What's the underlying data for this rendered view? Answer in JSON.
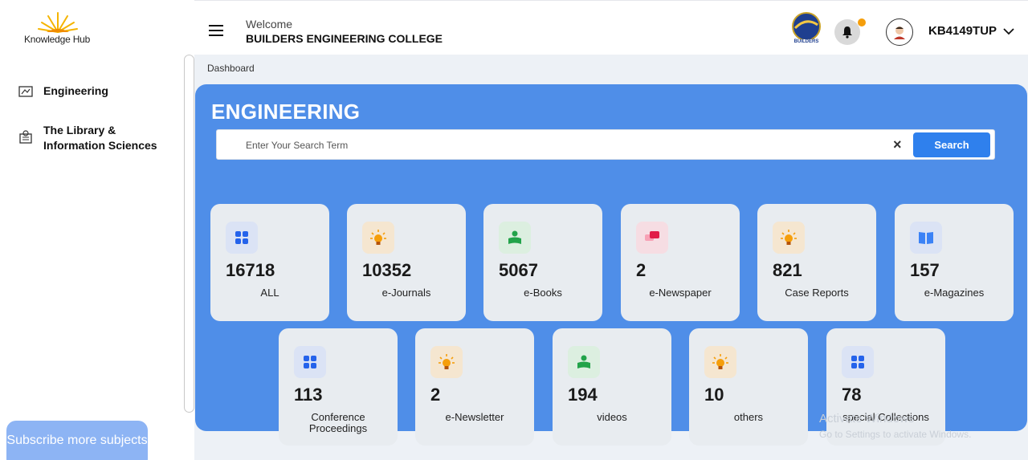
{
  "brand": {
    "logo_text": "Knowledge Hub"
  },
  "sidebar": {
    "items": [
      {
        "label": "Engineering",
        "icon": "engineering-icon"
      },
      {
        "label": "The Library &\nInformation Sciences",
        "icon": "library-icon"
      }
    ],
    "subscribe_label": "Subscribe more subjects"
  },
  "header": {
    "welcome": "Welcome",
    "college": "BUILDERS ENGINEERING COLLEGE",
    "college_logo_text": "BUILDERS",
    "user": "KB4149TUP"
  },
  "breadcrumb": "Dashboard",
  "panel": {
    "title": "ENGINEERING",
    "search_placeholder": "Enter Your Search Term",
    "clear_label": "×",
    "search_label": "Search"
  },
  "cards": [
    {
      "count": "16718",
      "label": "ALL",
      "icon": "grid-icon",
      "color": "blue"
    },
    {
      "count": "10352",
      "label": "e-Journals",
      "icon": "bulb-icon",
      "color": "orange"
    },
    {
      "count": "5067",
      "label": "e-Books",
      "icon": "reader-icon",
      "color": "green"
    },
    {
      "count": "2",
      "label": "e-Newspaper",
      "icon": "chat-icon",
      "color": "pink"
    },
    {
      "count": "821",
      "label": "Case Reports",
      "icon": "bulb-icon",
      "color": "orange"
    },
    {
      "count": "157",
      "label": "e-Magazines",
      "icon": "book-icon",
      "color": "blue"
    },
    {
      "count": "113",
      "label": "Conference Proceedings",
      "icon": "grid-icon",
      "color": "blue"
    },
    {
      "count": "2",
      "label": "e-Newsletter",
      "icon": "bulb-icon",
      "color": "orange"
    },
    {
      "count": "194",
      "label": "videos",
      "icon": "reader-icon",
      "color": "green"
    },
    {
      "count": "10",
      "label": "others",
      "icon": "bulb-icon",
      "color": "orange"
    },
    {
      "count": "78",
      "label": "special Collections",
      "icon": "grid-icon",
      "color": "blue"
    }
  ],
  "watermark": {
    "line1": "Activate Windows",
    "line2": "Go to Settings to activate Windows."
  },
  "colors": {
    "panel": "#4f8ee8",
    "search_button": "#2f80ed",
    "card": "#e8ecf0",
    "notification_dot": "#f59e0b"
  }
}
